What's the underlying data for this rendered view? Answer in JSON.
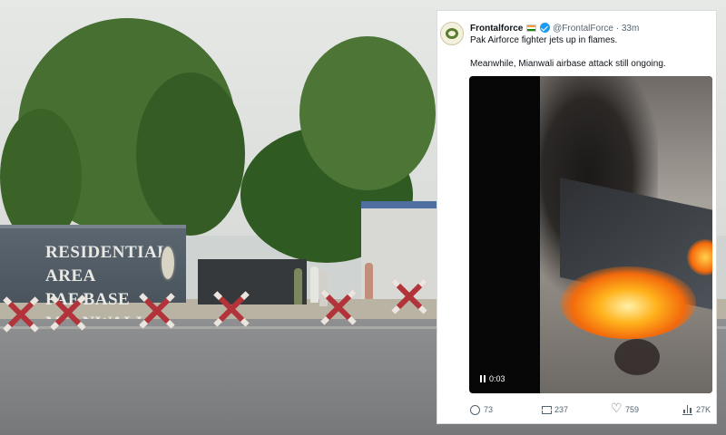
{
  "scene": {
    "wall_sign_line1": "RESIDENTIAL AREA",
    "wall_sign_line2": "PAF BASE MIANWALI"
  },
  "tweet": {
    "author_name": "Frontalforce",
    "author_handle": "@FrontalForce",
    "separator": "·",
    "timestamp": "33m",
    "text_line1": "Pak Airforce fighter jets up in flames.",
    "text_line2": "Meanwhile, Mianwali airbase attack still ongoing.",
    "video": {
      "elapsed_time": "0:03"
    },
    "actions": {
      "replies": "73",
      "reposts": "237",
      "likes": "759",
      "views": "27K"
    }
  }
}
